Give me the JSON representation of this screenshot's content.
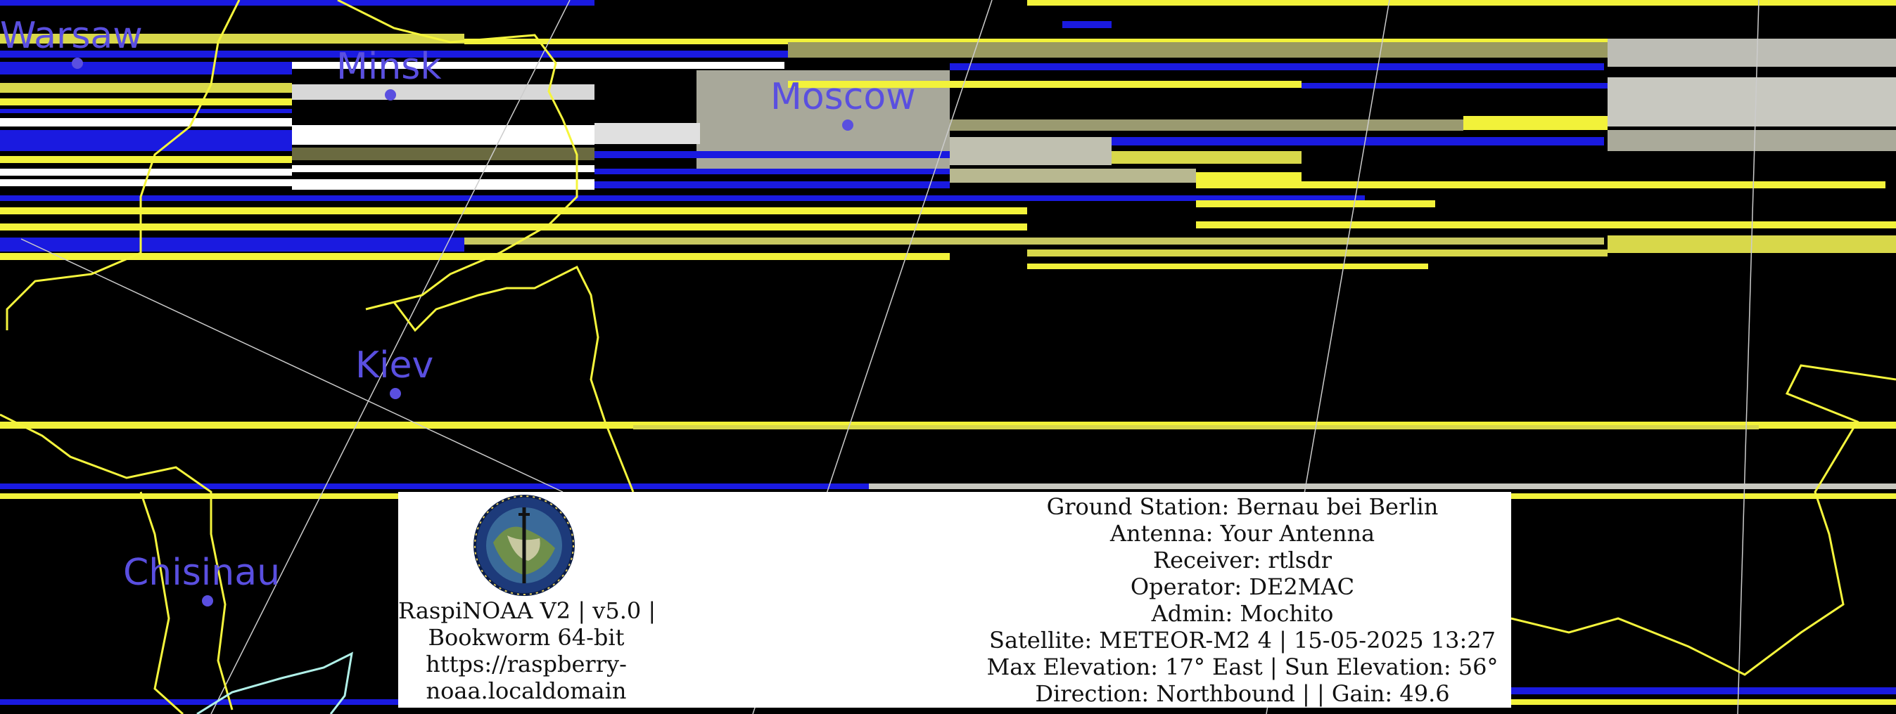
{
  "cities": [
    {
      "name": "Warsaw"
    },
    {
      "name": "Minsk"
    },
    {
      "name": "Moscow"
    },
    {
      "name": "Kiev"
    },
    {
      "name": "Chisinau"
    }
  ],
  "colors": {
    "stripe_yellow": "#f2f23a",
    "stripe_blue": "#1a1ae0",
    "border_yellow": "#f5f53c",
    "city_label": "#5a4fe0",
    "coast": "#b0f0e8",
    "grid": "#cccccc"
  },
  "info_panel": {
    "logo": "raspinoaa-logo-icon",
    "left_lines": [
      "RaspiNOAA V2 | v5.0 |",
      "Bookworm 64-bit",
      "https://raspberry-",
      "noaa.localdomain"
    ],
    "right_lines": [
      "Ground Station: Bernau bei Berlin",
      "Antenna: Your Antenna",
      "Receiver: rtlsdr",
      "Operator: DE2MAC",
      "Admin: Mochito",
      "Satellite: METEOR-M2 4 | 15-05-2025 13:27",
      "Max Elevation: 17° East | Sun Elevation: 56°",
      "Direction: Northbound | | Gain: 49.6"
    ]
  }
}
